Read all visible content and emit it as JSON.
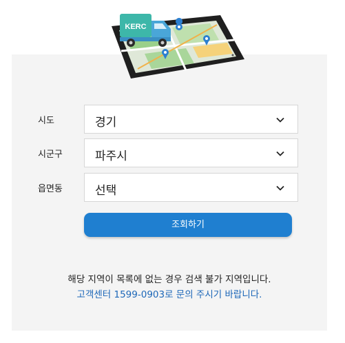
{
  "hero": {
    "badge_text": "KERC",
    "colors": {
      "tablet_frame": "#1f1f1f",
      "truck_teal": "#3db7a9",
      "truck_body": "#4aa6d8",
      "map_green": "#9ad08a",
      "pin_blue": "#2c7fd0"
    }
  },
  "form": {
    "rows": [
      {
        "label": "시도",
        "value": "경기"
      },
      {
        "label": "시군구",
        "value": "파주시"
      },
      {
        "label": "읍면동",
        "value": "선택"
      }
    ],
    "icon": "chevron-down-icon",
    "submit_label": "조회하기",
    "submit_color": "#1f7fd0"
  },
  "notice": {
    "line1": "해당 지역이 목록에 없는 경우 검색 불가 지역입니다.",
    "line2": "고객센터 1599-0903로 문의 주시기 바랍니다.",
    "line2_color": "#1d67b8"
  }
}
